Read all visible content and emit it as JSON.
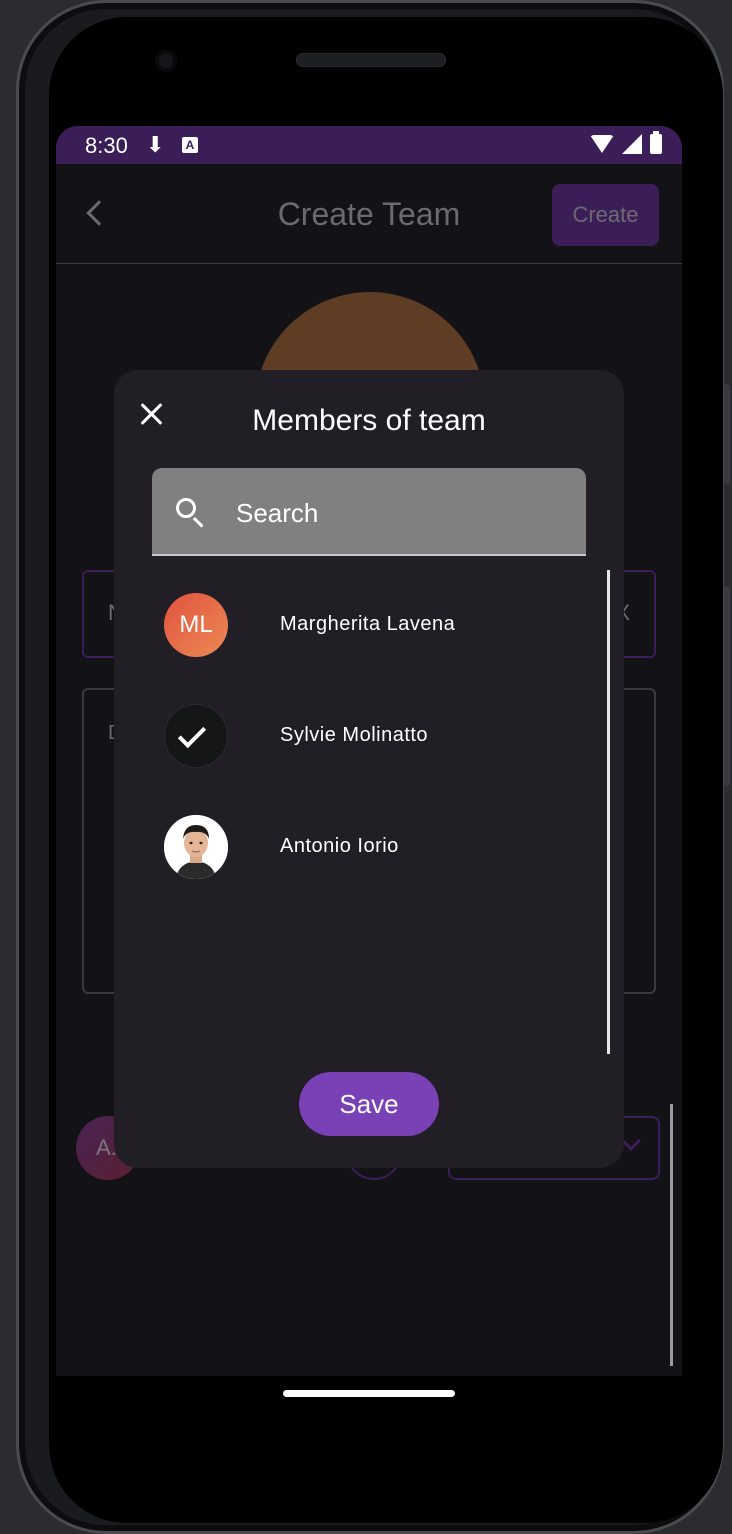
{
  "status_bar": {
    "time": "8:30",
    "download_glyph": "⬇",
    "app_badge": "A"
  },
  "app_bar": {
    "title": "Create Team",
    "create_label": "Create"
  },
  "background_form": {
    "name_hint": "N",
    "name_clear": "X",
    "description_hint": "D",
    "leader_initials": "A."
  },
  "dialog": {
    "title": "Members of team",
    "search_placeholder": "Search",
    "members": [
      {
        "name": "Margherita Lavena",
        "initials": "ML",
        "selected": false,
        "avatar": "initials"
      },
      {
        "name": "Sylvie Molinatto",
        "initials": "",
        "selected": true,
        "avatar": "photo-dark"
      },
      {
        "name": "Antonio Iorio",
        "initials": "",
        "selected": false,
        "avatar": "photo-portrait"
      }
    ],
    "save_label": "Save"
  },
  "colors": {
    "accent": "#7a41b6",
    "status_bar": "#3b1e58",
    "dialog_bg": "#211f25",
    "screen_bg": "#131216",
    "avatar_gradient_start": "#e0523e",
    "avatar_gradient_end": "#ec8a55"
  }
}
